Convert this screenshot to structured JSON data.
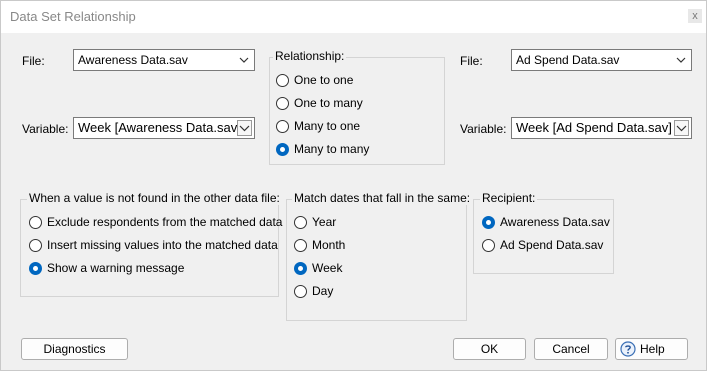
{
  "window": {
    "title": "Data Set Relationship",
    "close_glyph": "x"
  },
  "left_file": {
    "label": "File:",
    "value": "Awareness Data.sav"
  },
  "left_variable": {
    "label": "Variable:",
    "value": "Week [Awareness Data.sav]"
  },
  "right_file": {
    "label": "File:",
    "value": "Ad Spend Data.sav"
  },
  "right_variable": {
    "label": "Variable:",
    "value": "Week [Ad Spend Data.sav]"
  },
  "relationship": {
    "title": "Relationship:",
    "options": [
      "One to one",
      "One to many",
      "Many to one",
      "Many to many"
    ],
    "selected": "Many to many"
  },
  "not_found": {
    "title": "When a value is not found in the other data file:",
    "options": [
      "Exclude respondents from the matched data",
      "Insert missing values into the matched data",
      "Show a warning message"
    ],
    "selected": "Show a warning message"
  },
  "match_dates": {
    "title": "Match dates that fall in the same:",
    "options": [
      "Year",
      "Month",
      "Week",
      "Day"
    ],
    "selected": "Week"
  },
  "recipient": {
    "title": "Recipient:",
    "options": [
      "Awareness Data.sav",
      "Ad Spend Data.sav"
    ],
    "selected": "Awareness Data.sav"
  },
  "buttons": {
    "diagnostics": "Diagnostics",
    "ok": "OK",
    "cancel": "Cancel",
    "help": "Help"
  },
  "icons": {
    "dropdown": "chevron-down-icon",
    "help": "help-question-icon"
  },
  "colors": {
    "accent": "#0067c0"
  }
}
